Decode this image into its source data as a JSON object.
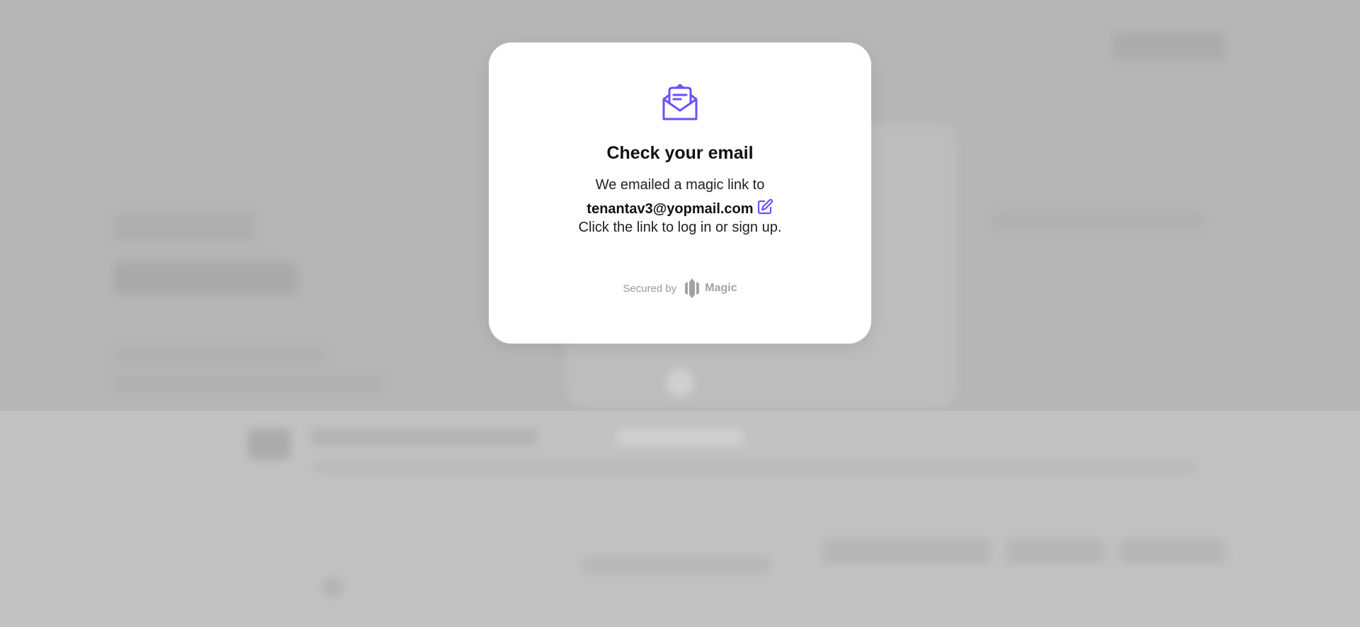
{
  "modal": {
    "title": "Check your email",
    "line1": "We emailed a magic link to",
    "email": "tenantav3@yopmail.com",
    "line3": "Click the link to log in or sign up.",
    "secured_by": "Secured by",
    "brand": "Magic"
  },
  "colors": {
    "accent": "#6851ff",
    "brand_gray": "#a3a3a3",
    "backdrop": "#b6b6b6"
  },
  "icons": {
    "email": "open-envelope-icon",
    "edit": "edit-icon",
    "brand": "magic-logo-icon"
  }
}
